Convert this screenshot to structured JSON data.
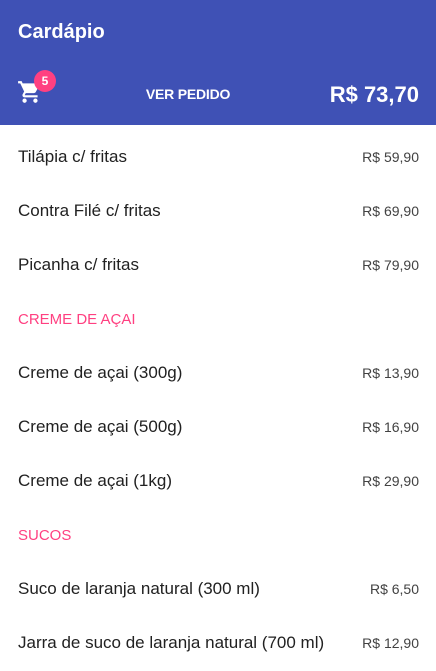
{
  "appbar": {
    "title": "Cardápio",
    "cart_count": "5",
    "view_order_label": "VER PEDIDO",
    "total": "R$ 73,70",
    "cart_icon": "shopping-cart-icon"
  },
  "colors": {
    "appbar": "#3f51b5",
    "accent": "#ff4081",
    "text": "#212121"
  },
  "menu": {
    "items": [
      {
        "name": "Tilápia c/ fritas",
        "price": "R$ 59,90"
      },
      {
        "name": "Contra Filé c/ fritas",
        "price": "R$ 69,90"
      },
      {
        "name": "Picanha c/ fritas",
        "price": "R$ 79,90"
      }
    ],
    "sections": [
      {
        "title": "CREME DE AÇAI",
        "items": [
          {
            "name": "Creme de açai (300g)",
            "price": "R$ 13,90"
          },
          {
            "name": "Creme de açai (500g)",
            "price": "R$ 16,90"
          },
          {
            "name": "Creme de açai (1kg)",
            "price": "R$ 29,90"
          }
        ]
      },
      {
        "title": "SUCOS",
        "items": [
          {
            "name": "Suco de laranja natural (300 ml)",
            "price": "R$ 6,50"
          },
          {
            "name": "Jarra de suco de laranja natural (700 ml)",
            "price": "R$ 12,90"
          }
        ]
      }
    ]
  }
}
